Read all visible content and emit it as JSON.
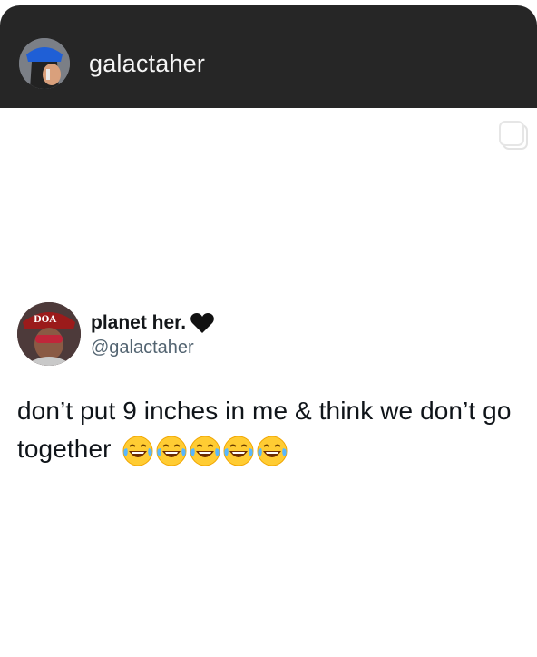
{
  "story_header": {
    "username": "galactaher",
    "avatar_icon": "profile-photo-icon"
  },
  "copy_icon": "copy-icon",
  "tweet": {
    "display_name": "planet her.",
    "name_emoji": "black-heart-icon",
    "handle": "@galactaher",
    "text": "don’t put 9 inches in me & think we don’t go together",
    "emojis": [
      "face-with-tears-of-joy-icon",
      "face-with-tears-of-joy-icon",
      "face-with-tears-of-joy-icon",
      "face-with-tears-of-joy-icon",
      "face-with-tears-of-joy-icon"
    ]
  },
  "colors": {
    "header_bg": "#262626",
    "text_primary": "#0f1419",
    "text_secondary": "#536471"
  }
}
